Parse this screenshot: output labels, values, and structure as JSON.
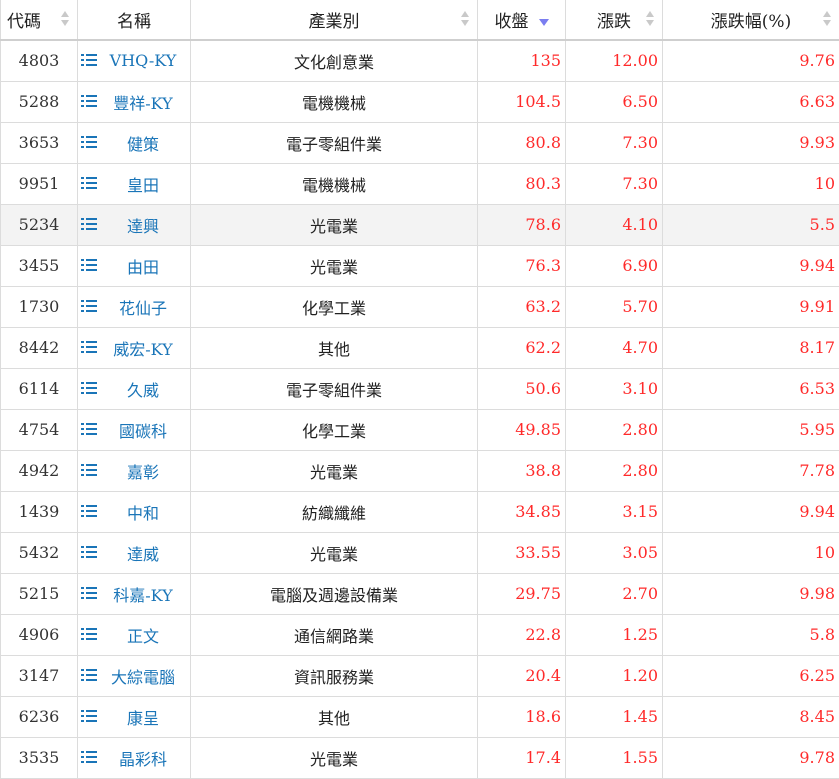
{
  "headers": {
    "code": "代碼",
    "name": "名稱",
    "industry": "產業別",
    "close": "收盤",
    "change": "漲跌",
    "change_pct": "漲跌幅(%)"
  },
  "colors": {
    "up": "#ff2a2a",
    "link": "#1a75b8",
    "sort_active": "#7b7ef0"
  },
  "icons": {
    "row_action": "list-icon",
    "sort_inactive": "sort-both-icon",
    "sort_active": "sort-desc-icon"
  },
  "sorted_by": "close",
  "highlighted_row": 4,
  "rows": [
    {
      "code": "4803",
      "name": "VHQ-KY",
      "industry": "文化創意業",
      "close": "135",
      "change": "12.00",
      "pct": "9.76"
    },
    {
      "code": "5288",
      "name": "豐祥-KY",
      "industry": "電機機械",
      "close": "104.5",
      "change": "6.50",
      "pct": "6.63"
    },
    {
      "code": "3653",
      "name": "健策",
      "industry": "電子零組件業",
      "close": "80.8",
      "change": "7.30",
      "pct": "9.93"
    },
    {
      "code": "9951",
      "name": "皇田",
      "industry": "電機機械",
      "close": "80.3",
      "change": "7.30",
      "pct": "10"
    },
    {
      "code": "5234",
      "name": "達興",
      "industry": "光電業",
      "close": "78.6",
      "change": "4.10",
      "pct": "5.5"
    },
    {
      "code": "3455",
      "name": "由田",
      "industry": "光電業",
      "close": "76.3",
      "change": "6.90",
      "pct": "9.94"
    },
    {
      "code": "1730",
      "name": "花仙子",
      "industry": "化學工業",
      "close": "63.2",
      "change": "5.70",
      "pct": "9.91"
    },
    {
      "code": "8442",
      "name": "威宏-KY",
      "industry": "其他",
      "close": "62.2",
      "change": "4.70",
      "pct": "8.17"
    },
    {
      "code": "6114",
      "name": "久威",
      "industry": "電子零組件業",
      "close": "50.6",
      "change": "3.10",
      "pct": "6.53"
    },
    {
      "code": "4754",
      "name": "國碳科",
      "industry": "化學工業",
      "close": "49.85",
      "change": "2.80",
      "pct": "5.95"
    },
    {
      "code": "4942",
      "name": "嘉彰",
      "industry": "光電業",
      "close": "38.8",
      "change": "2.80",
      "pct": "7.78"
    },
    {
      "code": "1439",
      "name": "中和",
      "industry": "紡織纖維",
      "close": "34.85",
      "change": "3.15",
      "pct": "9.94"
    },
    {
      "code": "5432",
      "name": "達威",
      "industry": "光電業",
      "close": "33.55",
      "change": "3.05",
      "pct": "10"
    },
    {
      "code": "5215",
      "name": "科嘉-KY",
      "industry": "電腦及週邊設備業",
      "close": "29.75",
      "change": "2.70",
      "pct": "9.98"
    },
    {
      "code": "4906",
      "name": "正文",
      "industry": "通信網路業",
      "close": "22.8",
      "change": "1.25",
      "pct": "5.8"
    },
    {
      "code": "3147",
      "name": "大綜電腦",
      "industry": "資訊服務業",
      "close": "20.4",
      "change": "1.20",
      "pct": "6.25"
    },
    {
      "code": "6236",
      "name": "康呈",
      "industry": "其他",
      "close": "18.6",
      "change": "1.45",
      "pct": "8.45"
    },
    {
      "code": "3535",
      "name": "晶彩科",
      "industry": "光電業",
      "close": "17.4",
      "change": "1.55",
      "pct": "9.78"
    }
  ]
}
